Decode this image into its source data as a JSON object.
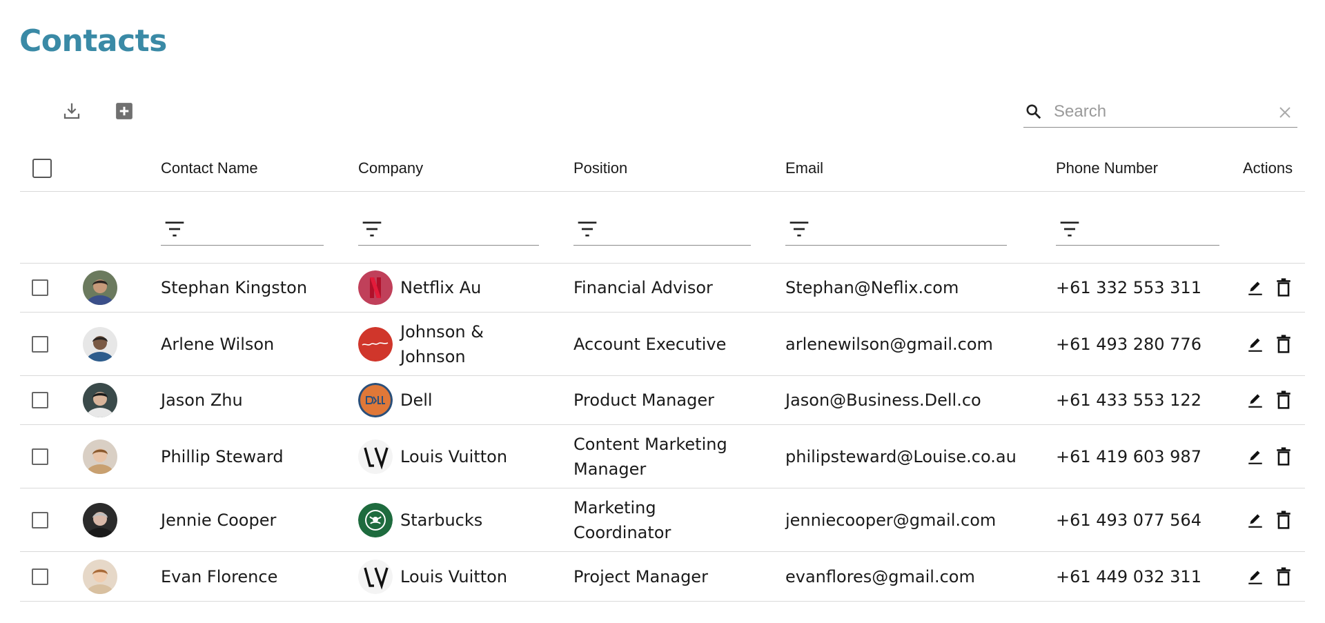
{
  "page": {
    "title": "Contacts"
  },
  "toolbar": {
    "download_icon": "download-icon",
    "add_icon": "add-box-icon"
  },
  "search": {
    "placeholder": "Search",
    "value": ""
  },
  "table": {
    "columns": [
      "Contact Name",
      "Company",
      "Position",
      "Email",
      "Phone Number",
      "Actions"
    ],
    "rows": [
      {
        "name": "Stephan Kingston",
        "company_line1": "Netflix Au",
        "company_line2": "",
        "position_line1": "Financial Advisor",
        "position_line2": "",
        "email": "Stephan@Neflix.com",
        "phone": "+61 332 553 311",
        "logo": "netflix-logo",
        "avatar_bg": "#6b7a5e",
        "avatar_skin": "#c79a7a",
        "avatar_hair": "#2b2420",
        "avatar_shirt": "#3b4f8a"
      },
      {
        "name": "Arlene Wilson",
        "company_line1": "Johnson &",
        "company_line2": "Johnson",
        "position_line1": "Account Executive",
        "position_line2": "",
        "email": "arlenewilson@gmail.com",
        "phone": "+61 493 280 776",
        "logo": "johnson-logo",
        "avatar_bg": "#e7e7e7",
        "avatar_skin": "#7a5a45",
        "avatar_hair": "#2a2420",
        "avatar_shirt": "#2d5c8c"
      },
      {
        "name": "Jason Zhu",
        "company_line1": "Dell",
        "company_line2": "",
        "position_line1": "Product Manager",
        "position_line2": "",
        "email": "Jason@Business.Dell.co",
        "phone": "+61 433 553 122",
        "logo": "dell-logo",
        "avatar_bg": "#3a4a4a",
        "avatar_skin": "#d8b49a",
        "avatar_hair": "#1a1a1a",
        "avatar_shirt": "#e8e8e8"
      },
      {
        "name": "Phillip Steward",
        "company_line1": "Louis Vuitton",
        "company_line2": "",
        "position_line1": "Content Marketing",
        "position_line2": "Manager",
        "email": "philipsteward@Louise.co.au",
        "phone": "+61 419 603 987",
        "logo": "lv-logo",
        "avatar_bg": "#d9cfc4",
        "avatar_skin": "#e8c4a8",
        "avatar_hair": "#8a5a2e",
        "avatar_shirt": "#c8a070"
      },
      {
        "name": "Jennie Cooper",
        "company_line1": "Starbucks",
        "company_line2": "",
        "position_line1": "Marketing",
        "position_line2": "Coordinator",
        "email": "jenniecooper@gmail.com",
        "phone": "+61 493 077 564",
        "logo": "starbucks-logo",
        "avatar_bg": "#2b2b2b",
        "avatar_skin": "#d8b8a8",
        "avatar_hair": "#bdbdbd",
        "avatar_shirt": "#1a1a1a"
      },
      {
        "name": "Evan Florence",
        "company_line1": "Louis Vuitton",
        "company_line2": "",
        "position_line1": "Project Manager",
        "position_line2": "",
        "email": "evanflores@gmail.com",
        "phone": "+61 449 032 311",
        "logo": "lv-logo",
        "avatar_bg": "#e6d8c8",
        "avatar_skin": "#f0cdb0",
        "avatar_hair": "#a86a38",
        "avatar_shirt": "#d8c0a0"
      }
    ]
  },
  "colors": {
    "title": "#3a8aa6",
    "netflix": "#c0405a",
    "johnson": "#d0362b",
    "dell": "#e07838",
    "starbucks": "#1e6b3e"
  },
  "actions": {
    "edit_icon": "edit-icon",
    "delete_icon": "delete-icon"
  }
}
